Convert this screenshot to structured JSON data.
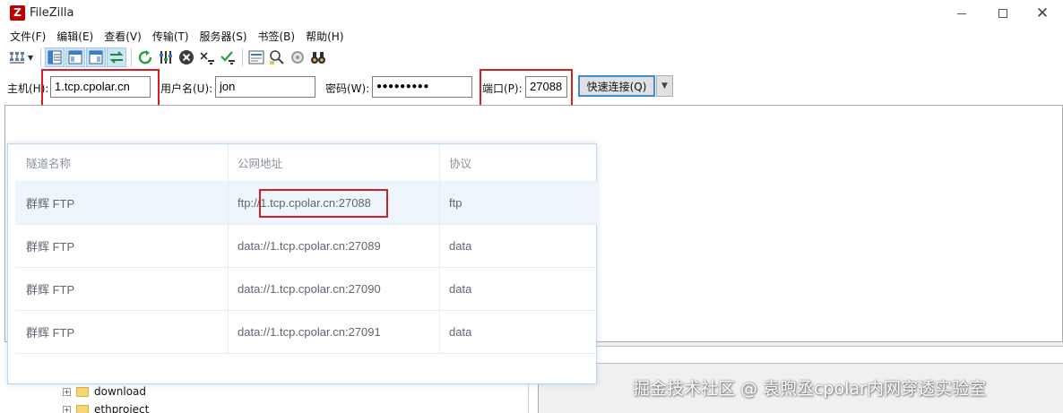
{
  "window": {
    "app_icon": "Z",
    "title": "FileZilla"
  },
  "menubar": {
    "items": [
      "文件(F)",
      "编辑(E)",
      "查看(V)",
      "传输(T)",
      "服务器(S)",
      "书签(B)",
      "帮助(H)"
    ]
  },
  "toolbar": {
    "icons": [
      "site-manager-icon",
      "toggle-message-log-icon",
      "toggle-local-tree-icon",
      "toggle-remote-tree-icon",
      "toggle-transfer-queue-icon",
      "refresh-icon",
      "process-queue-icon",
      "cancel-icon",
      "disconnect-icon",
      "reconnect-icon",
      "directory-filter-icon",
      "sync-browse-icon",
      "compare-icon",
      "search-binoculars-icon"
    ]
  },
  "quickconnect": {
    "host_label": "主机(H):",
    "host_value": "1.tcp.cpolar.cn",
    "user_label": "用户名(U):",
    "user_value": "jon",
    "pass_label": "密码(W):",
    "pass_value": "●●●●●●●●●",
    "port_label": "端口(P):",
    "port_value": "27088",
    "connect_label": "快速连接(Q)",
    "dropdown_glyph": "▼"
  },
  "tunnels": {
    "headers": [
      "隧道名称",
      "公网地址",
      "协议"
    ],
    "rows": [
      {
        "name": "群辉 FTP",
        "address": "ftp://1.tcp.cpolar.cn:27088",
        "protocol": "ftp"
      },
      {
        "name": "群辉 FTP",
        "address": "data://1.tcp.cpolar.cn:27089",
        "protocol": "data"
      },
      {
        "name": "群辉 FTP",
        "address": "data://1.tcp.cpolar.cn:27090",
        "protocol": "data"
      },
      {
        "name": "群辉 FTP",
        "address": "data://1.tcp.cpolar.cn:27091",
        "protocol": "data"
      }
    ]
  },
  "local_tree": {
    "items": [
      "download",
      "ethproject"
    ]
  },
  "watermark": "掘金技术社区 @ 袁煦丞cpolar内网穿透实验室",
  "colors": {
    "highlight_red": "#d42025",
    "selected_row": "#eef5fd",
    "connect_border": "#3c8fd6"
  }
}
